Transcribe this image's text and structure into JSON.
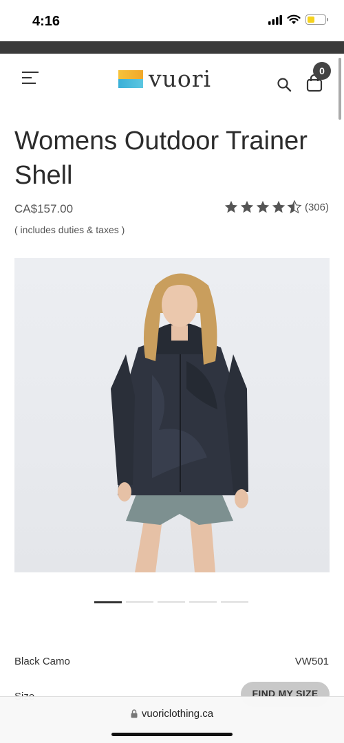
{
  "status_bar": {
    "time": "4:16",
    "icons": [
      "cellular-signal-icon",
      "wifi-icon",
      "battery-icon"
    ],
    "battery_level": 0.4,
    "battery_color": "#f5d21e"
  },
  "header": {
    "logo_text": "vuori",
    "cart_count": "0",
    "icons": [
      "menu-icon",
      "search-icon",
      "shopping-bag-icon"
    ]
  },
  "product": {
    "title": "Womens Outdoor Trainer Shell",
    "price": "CA$157.00",
    "duties_note": "( includes duties & taxes )",
    "rating": 4.5,
    "review_count": "(306)",
    "image_description_icon": "product-photo",
    "carousel": {
      "total": 5,
      "active": 1
    },
    "color": "Black Camo",
    "sku": "VW501",
    "size_label": "Size",
    "find_size_label": "FIND MY SIZE"
  },
  "browser": {
    "url": "vuoriclothing.ca"
  },
  "colors": {
    "dark_strip": "#3a3a3a",
    "badge": "#444444",
    "find_size_button": "#c8c8c8"
  }
}
